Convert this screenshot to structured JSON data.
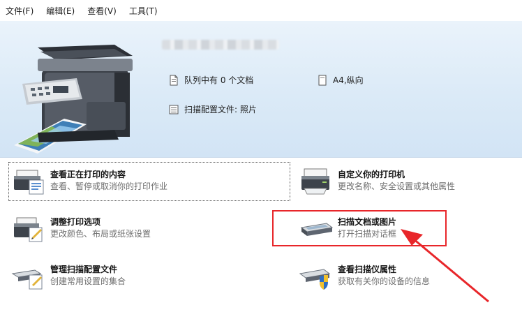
{
  "menu": {
    "file": "文件(F)",
    "edit": "编辑(E)",
    "view": "查看(V)",
    "tools": "工具(T)"
  },
  "printer": {
    "queue": "队列中有 0 个文档",
    "paper": "A4,纵向",
    "scan_profile": "扫描配置文件: 照片"
  },
  "tasks": [
    {
      "title": "查看正在打印的内容",
      "desc": "查看、暂停或取消你的打印作业"
    },
    {
      "title": "自定义你的打印机",
      "desc": "更改名称、安全设置或其他属性"
    },
    {
      "title": "调整打印选项",
      "desc": "更改颜色、布局或纸张设置"
    },
    {
      "title": "扫描文档或图片",
      "desc": "打开扫描对话框"
    },
    {
      "title": "管理扫描配置文件",
      "desc": "创建常用设置的集合"
    },
    {
      "title": "查看扫描仪属性",
      "desc": "获取有关你的设备的信息"
    }
  ],
  "colors": {
    "header_bg": "#dbeaf7",
    "highlight": "#e8262a",
    "desc_text": "#6d6d6d"
  }
}
